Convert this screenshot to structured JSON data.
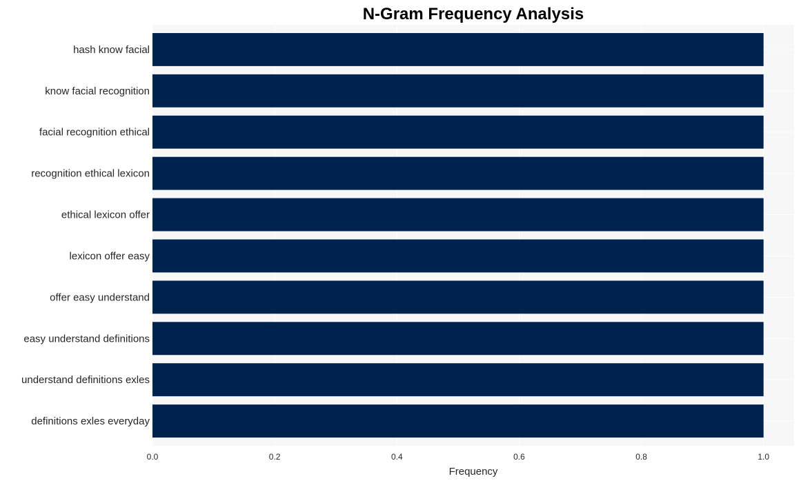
{
  "chart_data": {
    "type": "bar",
    "orientation": "horizontal",
    "title": "N-Gram Frequency Analysis",
    "xlabel": "Frequency",
    "ylabel": "",
    "categories": [
      "hash know facial",
      "know facial recognition",
      "facial recognition ethical",
      "recognition ethical lexicon",
      "ethical lexicon offer",
      "lexicon offer easy",
      "offer easy understand",
      "easy understand definitions",
      "understand definitions exles",
      "definitions exles everyday"
    ],
    "values": [
      1,
      1,
      1,
      1,
      1,
      1,
      1,
      1,
      1,
      1
    ],
    "xlim": [
      0,
      1.05
    ],
    "xticks": [
      0.0,
      0.2,
      0.4,
      0.6,
      0.8,
      1.0
    ],
    "xtick_labels": [
      "0.0",
      "0.2",
      "0.4",
      "0.6",
      "0.8",
      "1.0"
    ],
    "grid": true,
    "legend": "none",
    "colors": {
      "bar": "#00224e",
      "plot_background": "#f7f7f7",
      "grid": "#ffffff"
    }
  }
}
